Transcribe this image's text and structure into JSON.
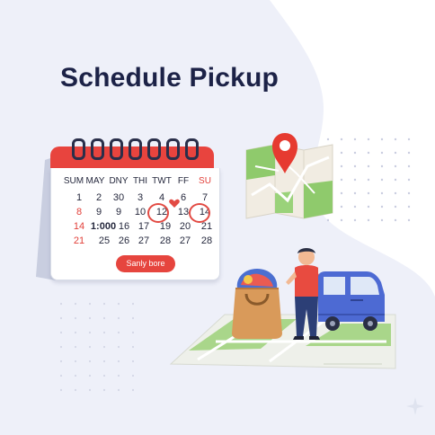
{
  "title": "Schedule Pickup",
  "calendar": {
    "headers": [
      "SUM",
      "MAY",
      "DNY",
      "THI",
      "TWT",
      "FF",
      "SU"
    ],
    "rows": [
      [
        "1",
        "2",
        "3",
        "4",
        "6",
        "7"
      ],
      [
        "8",
        "9",
        "10",
        "12",
        "13",
        "14"
      ],
      [
        "14",
        "1:000",
        "16",
        "17",
        "19",
        "20",
        "21"
      ],
      [
        "21",
        "25",
        "26",
        "27",
        "28",
        "27",
        "28"
      ]
    ],
    "row2": [
      "1",
      "2",
      "30",
      "3",
      "4",
      "6",
      "7"
    ],
    "row3": [
      "8",
      "9",
      "9",
      "10",
      "12",
      "13",
      "14"
    ],
    "row4": [
      "14",
      "1:000",
      "16",
      "17",
      "19",
      "20",
      "21"
    ],
    "row5": [
      "21",
      "25",
      "26",
      "27",
      "28",
      "27",
      "28"
    ],
    "button": "Sanly bore",
    "colors": {
      "accent": "#e6453e",
      "ink": "#1c2247"
    }
  },
  "icons": {
    "map": "map-icon",
    "pin": "location-pin-icon",
    "heart": "heart-icon",
    "bag": "laundry-bag-icon",
    "van": "van-icon",
    "person": "person-icon"
  }
}
